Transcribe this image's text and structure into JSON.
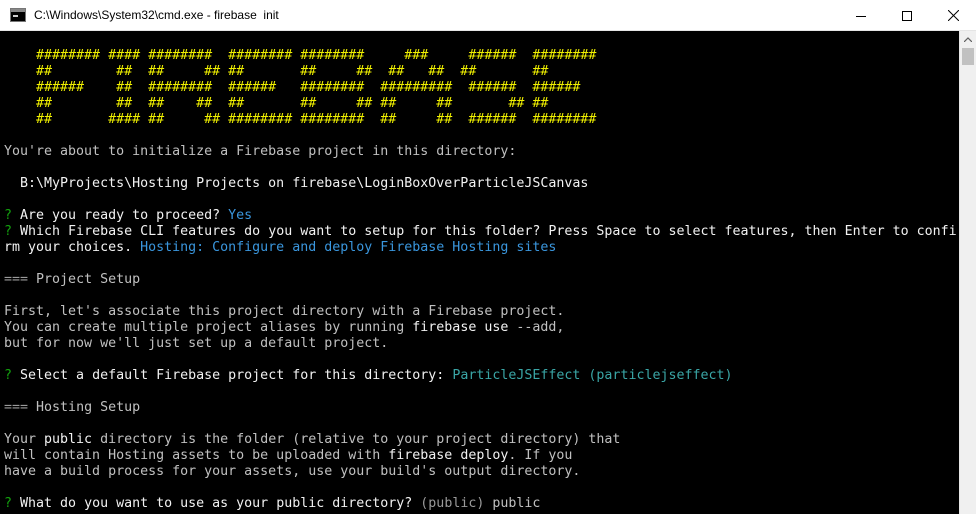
{
  "window": {
    "title": "C:\\Windows\\System32\\cmd.exe - firebase  init",
    "icon": "cmd-icon",
    "controls": [
      "minimize-icon",
      "maximize-icon",
      "close-icon"
    ]
  },
  "console": {
    "banner": [
      "    ######## #### ########  ######## ########     ###     ######  ########",
      "    ##        ##  ##     ## ##       ##     ##  ##   ##  ##       ##",
      "    ######    ##  ########  ######   ########  #########  ######  ######",
      "    ##        ##  ##    ##  ##       ##     ## ##     ##       ## ##",
      "    ##       #### ##     ## ######## ########  ##     ##  ######  ########"
    ],
    "intro": "You're about to initialize a Firebase project in this directory:",
    "directory": "  B:\\MyProjects\\Hosting Projects on firebase\\LoginBoxOverParticleJSCanvas",
    "q_mark": "?",
    "q1_text": " Are you ready to proceed? ",
    "q1_answer": "Yes",
    "q2_text": " Which Firebase CLI features do you want to setup for this folder? Press Space to select features, then Enter to confi",
    "q2_cont": "rm your choices. ",
    "q2_answer": "Hosting: Configure and deploy Firebase Hosting sites",
    "project_setup_prefix": "===",
    "project_setup_label": " Project Setup",
    "p1": "First, let's associate this project directory with a Firebase project.",
    "p2_pre": "You can create multiple project aliases by running ",
    "p2_cmd": "firebase use",
    "p2_post": " --add,",
    "p3": "but for now we'll just set up a default project.",
    "q3_text": " Select a default Firebase project for this directory: ",
    "q3_answer": "ParticleJSEffect (particlejseffect)",
    "hosting_setup_prefix": "===",
    "hosting_setup_label": " Hosting Setup",
    "h1_pre": "Your ",
    "h1_word": "public",
    "h1_post": " directory is the folder (relative to your project directory) that",
    "h2_pre": "will contain Hosting assets to be uploaded with ",
    "h2_cmd": "firebase deploy",
    "h2_post": ". If you",
    "h3": "have a build process for your assets, use your build's output directory.",
    "q4_text": " What do you want to use as your public directory? ",
    "q4_default": "(public)",
    "q4_value": " public"
  },
  "colors": {
    "banner": "#f0f000",
    "question_mark": "#13a10e",
    "answer": "#3a96dd"
  }
}
